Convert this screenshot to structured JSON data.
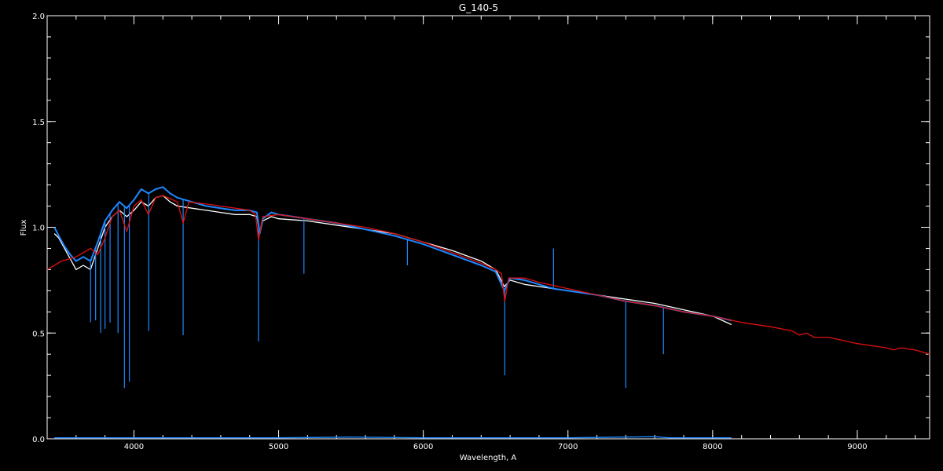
{
  "chart_data": {
    "type": "line",
    "title": "G_140-5",
    "xlabel": "Wavelength, A",
    "ylabel": "Flux",
    "xlim": [
      3400,
      9500
    ],
    "ylim": [
      0.0,
      2.0
    ],
    "x_ticks": [
      4000,
      5000,
      6000,
      7000,
      8000,
      9000
    ],
    "y_ticks": [
      0.0,
      0.5,
      1.0,
      1.5,
      2.0
    ],
    "x_minor_step": 200,
    "y_minor_step": 0.1,
    "grid": false,
    "background": "#000000",
    "axis_color": "#ffffff",
    "series": [
      {
        "color": "#ffffff",
        "points": [
          [
            3450,
            0.97
          ],
          [
            3480,
            0.95
          ],
          [
            3520,
            0.9
          ],
          [
            3560,
            0.85
          ],
          [
            3600,
            0.8
          ],
          [
            3650,
            0.82
          ],
          [
            3700,
            0.8
          ],
          [
            3750,
            0.9
          ],
          [
            3800,
            1.0
          ],
          [
            3850,
            1.05
          ],
          [
            3900,
            1.08
          ],
          [
            3950,
            1.05
          ],
          [
            4000,
            1.08
          ],
          [
            4050,
            1.12
          ],
          [
            4100,
            1.1
          ],
          [
            4150,
            1.14
          ],
          [
            4200,
            1.15
          ],
          [
            4250,
            1.12
          ],
          [
            4300,
            1.1
          ],
          [
            4400,
            1.09
          ],
          [
            4500,
            1.08
          ],
          [
            4600,
            1.07
          ],
          [
            4700,
            1.06
          ],
          [
            4800,
            1.06
          ],
          [
            4850,
            1.05
          ],
          [
            4870,
            0.97
          ],
          [
            4890,
            1.03
          ],
          [
            4950,
            1.05
          ],
          [
            5000,
            1.04
          ],
          [
            5200,
            1.03
          ],
          [
            5400,
            1.01
          ],
          [
            5600,
            0.99
          ],
          [
            5800,
            0.97
          ],
          [
            6000,
            0.93
          ],
          [
            6200,
            0.89
          ],
          [
            6400,
            0.84
          ],
          [
            6500,
            0.8
          ],
          [
            6560,
            0.72
          ],
          [
            6600,
            0.75
          ],
          [
            6700,
            0.73
          ],
          [
            6800,
            0.72
          ],
          [
            6900,
            0.71
          ],
          [
            7000,
            0.7
          ],
          [
            7200,
            0.68
          ],
          [
            7400,
            0.66
          ],
          [
            7600,
            0.64
          ],
          [
            7800,
            0.61
          ],
          [
            8000,
            0.58
          ],
          [
            8130,
            0.54
          ]
        ]
      },
      {
        "color": "#1e88ff",
        "points": [
          [
            3450,
            1.0
          ],
          [
            3480,
            0.96
          ],
          [
            3520,
            0.91
          ],
          [
            3560,
            0.87
          ],
          [
            3600,
            0.84
          ],
          [
            3650,
            0.86
          ],
          [
            3700,
            0.84
          ],
          [
            3750,
            0.93
          ],
          [
            3800,
            1.03
          ],
          [
            3850,
            1.08
          ],
          [
            3900,
            1.12
          ],
          [
            3950,
            1.09
          ],
          [
            4000,
            1.13
          ],
          [
            4050,
            1.18
          ],
          [
            4100,
            1.16
          ],
          [
            4150,
            1.18
          ],
          [
            4200,
            1.19
          ],
          [
            4250,
            1.16
          ],
          [
            4300,
            1.14
          ],
          [
            4400,
            1.12
          ],
          [
            4500,
            1.1
          ],
          [
            4600,
            1.09
          ],
          [
            4700,
            1.08
          ],
          [
            4800,
            1.08
          ],
          [
            4850,
            1.07
          ],
          [
            4870,
            0.97
          ],
          [
            4890,
            1.04
          ],
          [
            4950,
            1.07
          ],
          [
            5000,
            1.06
          ],
          [
            5200,
            1.04
          ],
          [
            5400,
            1.02
          ],
          [
            5600,
            0.99
          ],
          [
            5800,
            0.96
          ],
          [
            6000,
            0.92
          ],
          [
            6200,
            0.87
          ],
          [
            6400,
            0.82
          ],
          [
            6500,
            0.79
          ],
          [
            6560,
            0.7
          ],
          [
            6600,
            0.76
          ],
          [
            6700,
            0.75
          ],
          [
            6800,
            0.73
          ],
          [
            6900,
            0.71
          ],
          [
            7000,
            0.7
          ],
          [
            7200,
            0.68
          ],
          [
            7400,
            0.65
          ],
          [
            7600,
            0.63
          ],
          [
            7800,
            0.6
          ],
          [
            8000,
            0.58
          ],
          [
            8130,
            0.56
          ]
        ],
        "absorption_lines": [
          [
            3700,
            0.55
          ],
          [
            3735,
            0.56
          ],
          [
            3770,
            0.5
          ],
          [
            3800,
            0.52
          ],
          [
            3835,
            0.55
          ],
          [
            3890,
            0.5
          ],
          [
            3934,
            0.24
          ],
          [
            3968,
            0.27
          ],
          [
            4102,
            0.51
          ],
          [
            4340,
            0.49
          ],
          [
            4861,
            0.46
          ],
          [
            5175,
            0.78
          ],
          [
            5890,
            0.82
          ],
          [
            6563,
            0.3
          ],
          [
            7400,
            0.24
          ],
          [
            7660,
            0.4
          ]
        ],
        "emission_spikes": [
          [
            6900,
            0.9
          ]
        ]
      },
      {
        "color": "#e01010",
        "points": [
          [
            3400,
            0.8
          ],
          [
            3500,
            0.84
          ],
          [
            3600,
            0.86
          ],
          [
            3700,
            0.9
          ],
          [
            3750,
            0.87
          ],
          [
            3800,
            0.95
          ],
          [
            3850,
            1.05
          ],
          [
            3900,
            1.08
          ],
          [
            3950,
            0.98
          ],
          [
            4000,
            1.1
          ],
          [
            4050,
            1.13
          ],
          [
            4100,
            1.06
          ],
          [
            4150,
            1.14
          ],
          [
            4200,
            1.15
          ],
          [
            4300,
            1.12
          ],
          [
            4340,
            1.02
          ],
          [
            4380,
            1.12
          ],
          [
            4500,
            1.11
          ],
          [
            4600,
            1.1
          ],
          [
            4700,
            1.09
          ],
          [
            4800,
            1.08
          ],
          [
            4840,
            1.06
          ],
          [
            4861,
            0.94
          ],
          [
            4890,
            1.05
          ],
          [
            5000,
            1.06
          ],
          [
            5200,
            1.04
          ],
          [
            5400,
            1.02
          ],
          [
            5600,
            1.0
          ],
          [
            5800,
            0.97
          ],
          [
            6000,
            0.93
          ],
          [
            6200,
            0.88
          ],
          [
            6400,
            0.83
          ],
          [
            6500,
            0.8
          ],
          [
            6540,
            0.78
          ],
          [
            6563,
            0.65
          ],
          [
            6590,
            0.76
          ],
          [
            6700,
            0.76
          ],
          [
            6800,
            0.74
          ],
          [
            7000,
            0.71
          ],
          [
            7200,
            0.68
          ],
          [
            7400,
            0.65
          ],
          [
            7600,
            0.63
          ],
          [
            7800,
            0.6
          ],
          [
            8000,
            0.58
          ],
          [
            8200,
            0.55
          ],
          [
            8400,
            0.53
          ],
          [
            8550,
            0.51
          ],
          [
            8600,
            0.49
          ],
          [
            8650,
            0.5
          ],
          [
            8700,
            0.48
          ],
          [
            8800,
            0.48
          ],
          [
            9000,
            0.45
          ],
          [
            9200,
            0.43
          ],
          [
            9250,
            0.42
          ],
          [
            9300,
            0.43
          ],
          [
            9400,
            0.42
          ],
          [
            9500,
            0.4
          ]
        ]
      },
      {
        "color": "#1e88ff",
        "points": [
          [
            3450,
            0.005
          ],
          [
            4000,
            0.005
          ],
          [
            5000,
            0.005
          ],
          [
            5500,
            0.008
          ],
          [
            6000,
            0.005
          ],
          [
            7000,
            0.005
          ],
          [
            7600,
            0.01
          ],
          [
            7700,
            0.005
          ],
          [
            8130,
            0.005
          ]
        ]
      }
    ]
  }
}
